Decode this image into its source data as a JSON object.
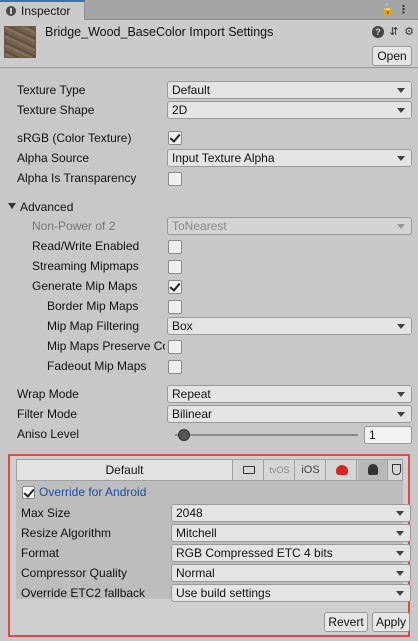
{
  "tab": {
    "label": "Inspector"
  },
  "header": {
    "title": "Bridge_Wood_BaseColor Import Settings",
    "open_label": "Open"
  },
  "fields": {
    "texture_type": {
      "label": "Texture Type",
      "value": "Default"
    },
    "texture_shape": {
      "label": "Texture Shape",
      "value": "2D"
    },
    "srgb": {
      "label": "sRGB (Color Texture)",
      "checked": true
    },
    "alpha_source": {
      "label": "Alpha Source",
      "value": "Input Texture Alpha"
    },
    "alpha_transparency": {
      "label": "Alpha Is Transparency",
      "checked": false
    }
  },
  "advanced": {
    "label": "Advanced",
    "npot": {
      "label": "Non-Power of 2",
      "value": "ToNearest"
    },
    "read_write": {
      "label": "Read/Write Enabled",
      "checked": false
    },
    "streaming_mipmaps": {
      "label": "Streaming Mipmaps",
      "checked": false
    },
    "generate_mipmaps": {
      "label": "Generate Mip Maps",
      "checked": true
    },
    "border_mipmaps": {
      "label": "Border Mip Maps",
      "checked": false
    },
    "mipmap_filtering": {
      "label": "Mip Map Filtering",
      "value": "Box"
    },
    "mipmaps_preserve": {
      "label": "Mip Maps Preserve Co",
      "checked": false
    },
    "fadeout_mipmaps": {
      "label": "Fadeout Mip Maps",
      "checked": false
    }
  },
  "wrap": {
    "label": "Wrap Mode",
    "value": "Repeat"
  },
  "filter": {
    "label": "Filter Mode",
    "value": "Bilinear"
  },
  "aniso": {
    "label": "Aniso Level",
    "value": "1",
    "slider_fraction": 0.0625
  },
  "platform": {
    "default_tab": "Default",
    "tabs": [
      {
        "name": "standalone",
        "icon": "monitor-icon"
      },
      {
        "name": "tvos",
        "label": "tvOS"
      },
      {
        "name": "ios",
        "label": "iOS"
      },
      {
        "name": "unity-ghost",
        "icon": "ghost-icon"
      },
      {
        "name": "android",
        "icon": "android-icon",
        "selected": true
      },
      {
        "name": "webgl",
        "icon": "html5-icon"
      }
    ],
    "override_label": "Override for Android",
    "override_checked": true,
    "max_size": {
      "label": "Max Size",
      "value": "2048"
    },
    "resize": {
      "label": "Resize Algorithm",
      "value": "Mitchell"
    },
    "format": {
      "label": "Format",
      "value": "RGB Compressed ETC 4 bits"
    },
    "quality": {
      "label": "Compressor Quality",
      "value": "Normal"
    },
    "etc2_fallback": {
      "label": "Override ETC2 fallback",
      "value": "Use build settings"
    }
  },
  "buttons": {
    "revert": "Revert",
    "apply": "Apply"
  },
  "colors": {
    "highlight_border": "#e04848",
    "link": "#1a4ea0",
    "tab_accent": "#3a72b0"
  }
}
